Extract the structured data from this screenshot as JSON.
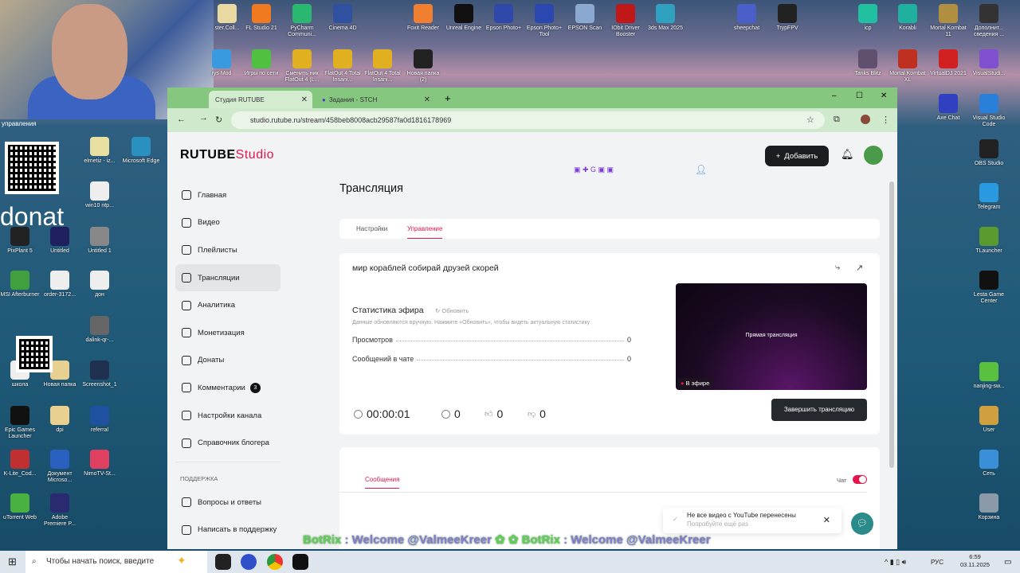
{
  "desktop": {
    "icons": [
      "ster.Coll...",
      "FL Studio 21",
      "PyCharm Communi...",
      "Cinema 4D",
      "Foxit Reader",
      "Unreal Engine",
      "Epson Photo+",
      "Epson Photo+ Tool",
      "EPSON Scan",
      "IObit Driver Booster",
      "3ds Max 2025",
      "sheepchat",
      "TrypFPV",
      "icp",
      "Korabli",
      "Mortal Kombat 11",
      "Дополнит... сведения ...",
      "rys Mod",
      "Игры по сети",
      "Сменить ник FlatOut 4 (L...",
      "FlatOut 4 Total Insani...",
      "FlatOut 4 Total Insani...",
      "Новая папка (2)",
      "Tanks Blitz",
      "Mortal Kombat XL",
      "VirtualDJ 2021",
      "VisualStudi...",
      "Axe Chat",
      "Visual Studio Code",
      "OBS Studio",
      "Telegram",
      "TLauncher",
      "Lesta Game Center",
      "nanjing-sw...",
      "User",
      "Сеть",
      "Корзина",
      "elmetiz - iz...",
      "Microsoft Edge",
      "win10 ntp...",
      "PixPlant 5",
      "Untitled",
      "Untitled 1",
      "MSI Afterburner",
      "order-3172...",
      "дон",
      "dalink-qr-...",
      "школа",
      "Новая папка",
      "Screenshot_1",
      "Epic Games Launcher",
      "dpi",
      "referral",
      "K-Lite_Cod...",
      "Документ Microso...",
      "NimoTV-St...",
      "uTorrent Web",
      "Adobe Premiere P..."
    ],
    "webcam_label": "управления",
    "donat_text": "donat"
  },
  "browser": {
    "tabs": [
      {
        "label": "Студия RUTUBE"
      },
      {
        "label": "Задания - STCH"
      }
    ],
    "url": "studio.rutube.ru/stream/458beb8008acb29587fa0d1816178969"
  },
  "app": {
    "logo": "RUTUBE",
    "logo_suffix": "Studio",
    "add_button": "Добавить",
    "sidebar": {
      "items": [
        {
          "label": "Главная"
        },
        {
          "label": "Видео"
        },
        {
          "label": "Плейлисты"
        },
        {
          "label": "Трансляции",
          "selected": true
        },
        {
          "label": "Аналитика"
        },
        {
          "label": "Монетизация"
        },
        {
          "label": "Донаты"
        },
        {
          "label": "Комментарии",
          "badge": "3"
        },
        {
          "label": "Настройки канала"
        },
        {
          "label": "Справочник блогера"
        }
      ],
      "support_header": "ПОДДЕРЖКА",
      "support": [
        {
          "label": "Вопросы и ответы"
        },
        {
          "label": "Написать в поддержку"
        }
      ]
    },
    "page_title": "Трансляция",
    "tabs": [
      {
        "label": "Настройки"
      },
      {
        "label": "Управление",
        "active": true
      }
    ],
    "stream": {
      "title": "мир кораблей собирай друзей скорей",
      "stats_title": "Статистика эфира",
      "refresh": "Обновить",
      "stats_note": "Данные обновляются вручную. Нажмите «Обновить», чтобы видеть актуальную статистику",
      "stats": [
        {
          "label": "Просмотров",
          "value": "0"
        },
        {
          "label": "Сообщений в чате",
          "value": "0"
        }
      ],
      "preview_label": "Прямая трансляция",
      "live_badge": "В эфире",
      "end_button": "Завершить трансляцию",
      "duration": "00:00:01",
      "viewers": "0",
      "likes": "0",
      "dislikes": "0"
    },
    "chat": {
      "tab": "Сообщения",
      "toggle_label": "Чат",
      "toggle_on": true
    },
    "toast": {
      "title": "Не все видео с YouTube перенесены",
      "subtitle": "Попробуйте ещё раз"
    },
    "accent": "#e4164d"
  },
  "overlay": {
    "bot": "BotRix",
    "text": " : Welcome @ValmeeKreer"
  },
  "taskbar": {
    "search_placeholder": "Чтобы начать поиск, введите",
    "lang": "РУС",
    "time": "6:59",
    "date": "03.11.2025"
  }
}
